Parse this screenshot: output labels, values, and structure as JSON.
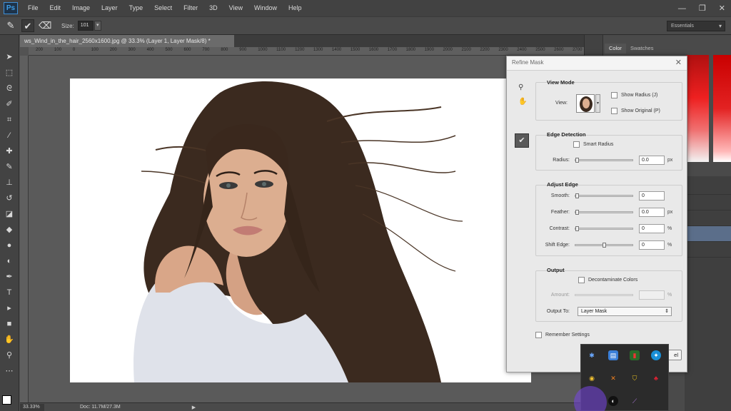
{
  "app": {
    "logo": "Ps"
  },
  "menu": [
    "File",
    "Edit",
    "Image",
    "Layer",
    "Type",
    "Select",
    "Filter",
    "3D",
    "View",
    "Window",
    "Help"
  ],
  "window_controls": {
    "minimize": "—",
    "restore": "❐",
    "close": "✕"
  },
  "options_bar": {
    "size_label": "Size:",
    "size_value": "101",
    "workspace": "Essentials"
  },
  "document": {
    "tab_title": "ws_Wind_in_the_hair_2560x1600.jpg @ 33.3% (Layer 1, Layer Mask/8) *",
    "ruler_marks": [
      "200",
      "100",
      "0",
      "100",
      "200",
      "300",
      "400",
      "500",
      "600",
      "700",
      "800",
      "900",
      "1000",
      "1100",
      "1200",
      "1300",
      "1400",
      "1500",
      "1600",
      "1700",
      "1800",
      "1900",
      "2000",
      "2100",
      "2200",
      "2300",
      "2400",
      "2500",
      "2600",
      "2700"
    ],
    "zoom": "33.33%",
    "doc_info": "Doc: 11.7M/27.3M"
  },
  "right_panel": {
    "tabs": [
      "Color",
      "Swatches"
    ]
  },
  "dialog": {
    "title": "Refine Mask",
    "view_mode": {
      "title": "View Mode",
      "view_label": "View:",
      "show_radius": "Show Radius (J)",
      "show_original": "Show Original (P)"
    },
    "edge_detection": {
      "title": "Edge Detection",
      "smart_radius": "Smart Radius",
      "radius_label": "Radius:",
      "radius_value": "0.0",
      "radius_unit": "px"
    },
    "adjust_edge": {
      "title": "Adjust Edge",
      "smooth_label": "Smooth:",
      "smooth_value": "0",
      "feather_label": "Feather:",
      "feather_value": "0.0",
      "feather_unit": "px",
      "contrast_label": "Contrast:",
      "contrast_value": "0",
      "contrast_unit": "%",
      "shift_label": "Shift Edge:",
      "shift_value": "0",
      "shift_unit": "%"
    },
    "output": {
      "title": "Output",
      "decontaminate": "Decontaminate Colors",
      "amount_label": "Amount:",
      "amount_unit": "%",
      "output_to_label": "Output To:",
      "output_to_value": "Layer Mask"
    },
    "remember": "Remember Settings",
    "cancel_partial": "el"
  },
  "colors": {
    "menubar": "#424242",
    "panel": "#535353",
    "dialog_bg": "#e9e9e9",
    "selected_layer": "#5b6e8a",
    "cursor_highlight": "#7846e6"
  }
}
